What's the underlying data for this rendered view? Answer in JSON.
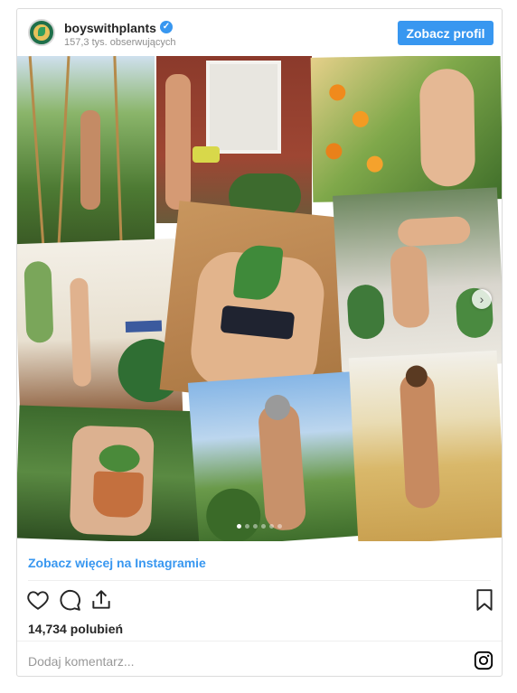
{
  "header": {
    "username": "boyswithplants",
    "followers": "157,3 tys. obserwujących",
    "profile_button": "Zobacz profil",
    "avatar_icon": "plant-logo-avatar"
  },
  "colors": {
    "accent": "#3897f0",
    "text": "#262626",
    "muted": "#8e8e8e",
    "border": "#dbdbdb"
  },
  "carousel": {
    "photos": [
      "garden-sticks-photo",
      "watering-can-photo",
      "orange-tree-photo",
      "leaf-lying-photo",
      "yoga-plants-photo",
      "handstand-room-photo",
      "pot-holding-photo",
      "bearded-garden-photo",
      "wheat-field-photo"
    ],
    "slide_count": 6,
    "active_slide": 1,
    "next_icon": "chevron-right-icon"
  },
  "footer": {
    "see_more": "Zobacz więcej na Instagramie",
    "likes": "14,734 polubień",
    "comment_placeholder": "Dodaj komentarz...",
    "icons": [
      "heart-icon",
      "comment-icon",
      "share-icon",
      "bookmark-icon",
      "instagram-icon"
    ]
  }
}
